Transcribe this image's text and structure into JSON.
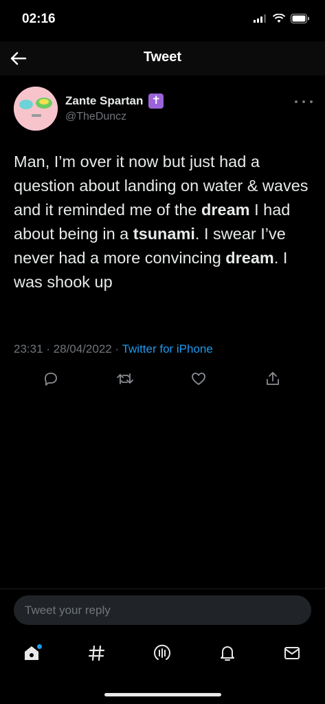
{
  "status_bar": {
    "time": "02:16"
  },
  "header": {
    "title": "Tweet"
  },
  "tweet": {
    "display_name": "Zante Spartan",
    "badge": "✝",
    "handle": "@TheDuncz",
    "text_parts": [
      "Man, I’m over it now but just had a question about landing on water & waves and it reminded me of the ",
      "dream",
      " I had about being in a ",
      "tsunami",
      ". I swear I’ve never had a more convincing ",
      "dream",
      ". I was shook up"
    ],
    "time": "23:31",
    "date": "28/04/2022",
    "source": "Twitter for iPhone"
  },
  "reply": {
    "placeholder": "Tweet your reply"
  },
  "icons": {
    "back": "arrow-left-icon",
    "more": "more-dots-icon",
    "reply": "reply-icon",
    "retweet": "retweet-icon",
    "like": "heart-icon",
    "share": "share-icon",
    "home": "home-icon",
    "explore": "hashtag-icon",
    "spaces": "spaces-icon",
    "notifications": "bell-icon",
    "messages": "mail-icon"
  },
  "colors": {
    "accent": "#1d9bf0",
    "badge": "#9b63d8",
    "muted": "#71767b"
  }
}
